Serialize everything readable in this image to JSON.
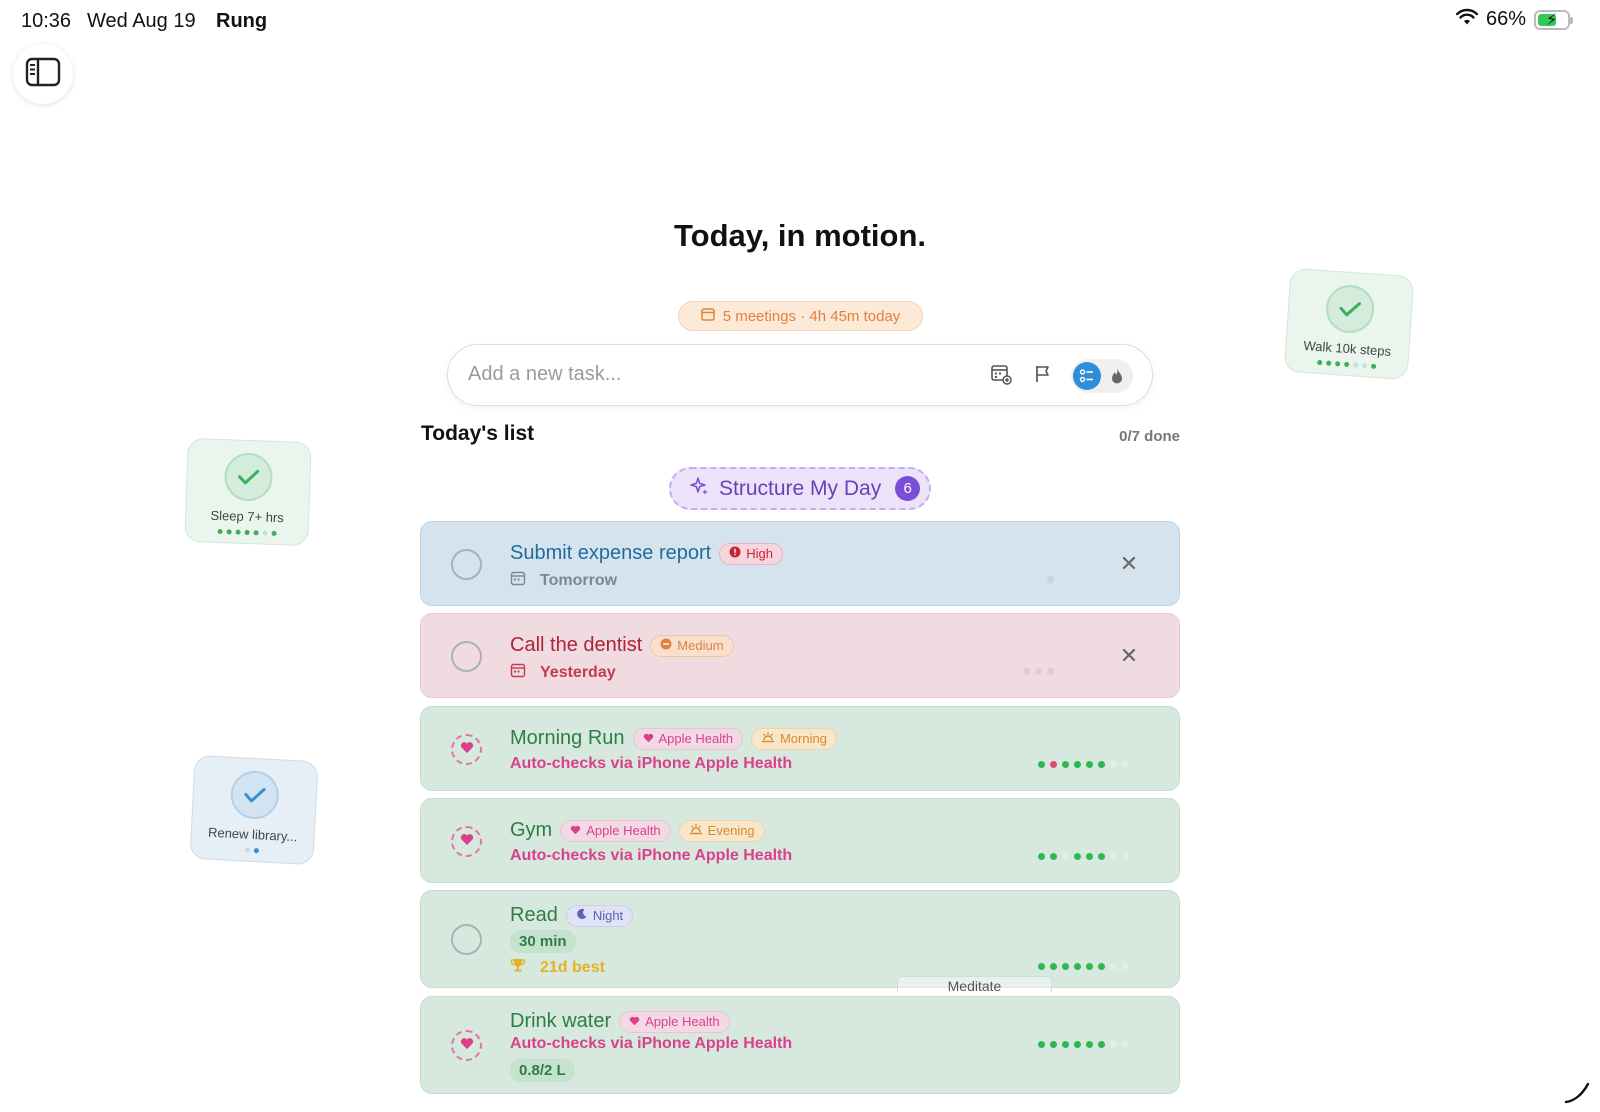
{
  "status_bar": {
    "time": "10:36",
    "date": "Wed Aug 19",
    "app_name": "Rung",
    "battery": "66%"
  },
  "page_title": "Today, in motion.",
  "meetings_summary": "5 meetings · 4h 45m today",
  "add_task": {
    "placeholder": "Add a new task..."
  },
  "list": {
    "title": "Today's list",
    "done_count": "0/7 done"
  },
  "structure_button": {
    "label": "Structure My Day",
    "badge": "6"
  },
  "tasks": [
    {
      "title": "Submit expense report",
      "badge": "High",
      "subtitle": "Tomorrow",
      "kind": "due",
      "color": "#1f6d9c"
    },
    {
      "title": "Call the dentist",
      "badge": "Medium",
      "subtitle": "Yesterday",
      "kind": "overdue",
      "color": "#b0223a"
    },
    {
      "title": "Morning Run",
      "source": "Apple Health",
      "time_of_day": "Morning",
      "subtitle": "Auto-checks via iPhone Apple Health",
      "streak_dots": [
        "green",
        "red",
        "green",
        "green",
        "green",
        "green",
        "faint",
        "faint"
      ]
    },
    {
      "title": "Gym",
      "source": "Apple Health",
      "time_of_day": "Evening",
      "subtitle": "Auto-checks via iPhone Apple Health",
      "streak_dots": [
        "green",
        "green",
        "faint",
        "green",
        "green",
        "green",
        "faint",
        "faint"
      ]
    },
    {
      "title": "Read",
      "time_of_day": "Night",
      "duration": "30 min",
      "best": "21d best",
      "streak_dots": [
        "green",
        "green",
        "green",
        "green",
        "green",
        "green",
        "faint",
        "faint"
      ]
    },
    {
      "title": "Drink water",
      "source": "Apple Health",
      "subtitle": "Auto-checks via iPhone Apple Health",
      "progress": "0.8/2 L",
      "streak_dots": [
        "green",
        "green",
        "green",
        "green",
        "green",
        "green",
        "faint",
        "faint"
      ]
    }
  ],
  "ghost_label": "Meditate",
  "widgets": [
    {
      "label": "Walk 10k steps",
      "icon": "check-icon",
      "color": "#3fae5a"
    },
    {
      "label": "Sleep 7+ hrs",
      "icon": "check-icon",
      "color": "#3fae5a"
    },
    {
      "label": "Renew library...",
      "icon": "check-icon",
      "color": "#3a8fd0"
    }
  ],
  "colors": {
    "accent": "#2f8fd6",
    "purple": "#7a4ed6",
    "health_pink": "#d9418a",
    "green_text": "#2e8a4a"
  }
}
